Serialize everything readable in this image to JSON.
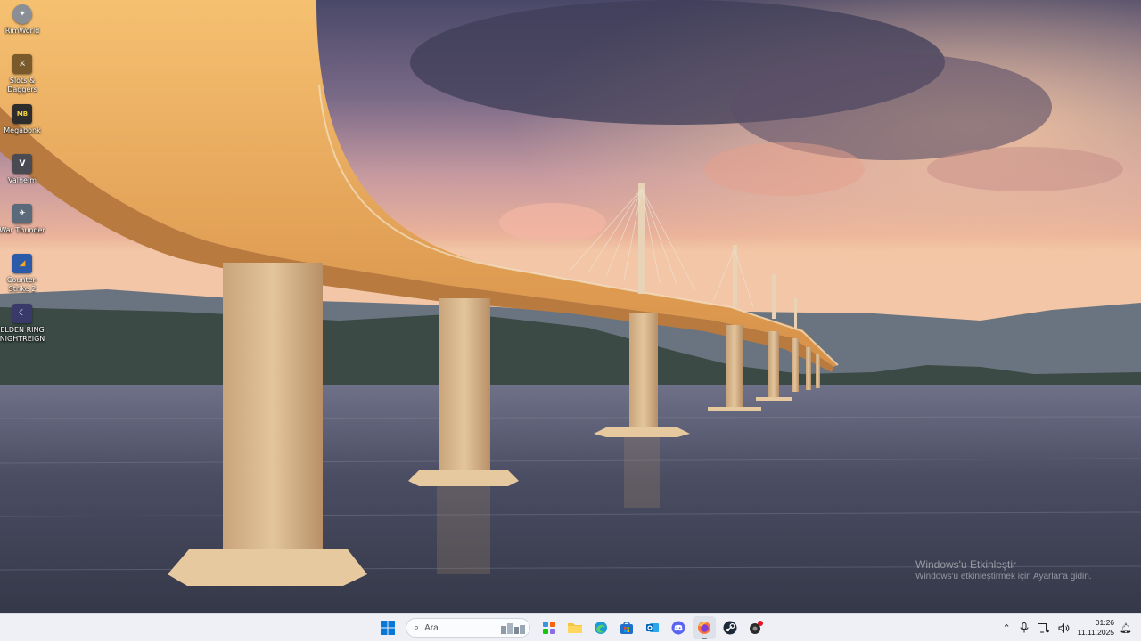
{
  "desktop": {
    "icons": [
      {
        "label": "RimWorld",
        "icon": "rimworld-icon",
        "color": "#8a8f96"
      },
      {
        "label": "Slots & Daggers",
        "icon": "slots-daggers-icon",
        "color": "#7a5a2a"
      },
      {
        "label": "Megabonk",
        "icon": "megabonk-icon",
        "color": "#2d2d2d"
      },
      {
        "label": "Valheim",
        "icon": "valheim-icon",
        "color": "#4a4a52"
      },
      {
        "label": "War Thunder",
        "icon": "war-thunder-icon",
        "color": "#5a6a7a"
      },
      {
        "label": "Counter-Strike 2",
        "icon": "counter-strike-icon",
        "color": "#2a5aa8"
      },
      {
        "label": "ELDEN RING NIGHTREIGN",
        "icon": "elden-ring-icon",
        "color": "#3a3a6a"
      }
    ]
  },
  "watermark": {
    "line1": "Windows'u Etkinleştir",
    "line2": "Windows'u etkinleştirmek için Ayarlar'a gidin."
  },
  "taskbar": {
    "search_placeholder": "Ara",
    "apps": [
      {
        "name": "start",
        "icon": "windows-start-icon"
      },
      {
        "name": "widgets",
        "icon": "widgets-icon"
      },
      {
        "name": "file-explorer",
        "icon": "folder-icon"
      },
      {
        "name": "edge",
        "icon": "edge-icon"
      },
      {
        "name": "store",
        "icon": "store-icon"
      },
      {
        "name": "outlook",
        "icon": "outlook-icon"
      },
      {
        "name": "discord",
        "icon": "discord-icon"
      },
      {
        "name": "firefox",
        "icon": "firefox-icon"
      },
      {
        "name": "steam",
        "icon": "steam-icon"
      },
      {
        "name": "app",
        "icon": "app-notification-icon"
      }
    ],
    "tray": {
      "time": "01:26",
      "date": "11.11.2025"
    }
  },
  "colors": {
    "accent": "#0067c0",
    "taskbar_bg": "#eef0f6"
  }
}
